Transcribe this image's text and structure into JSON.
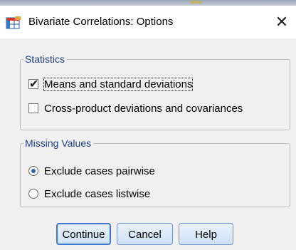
{
  "window": {
    "title": "Bivariate Correlations: Options",
    "close_glyph": "✕"
  },
  "statistics": {
    "legend": "Statistics",
    "means": {
      "label": "Means and standard deviations",
      "checked": true
    },
    "cross": {
      "label": "Cross-product deviations and covariances",
      "checked": false
    }
  },
  "missing_values": {
    "legend": "Missing Values",
    "pairwise": {
      "label": "Exclude cases pairwise",
      "selected": true
    },
    "listwise": {
      "label": "Exclude cases listwise",
      "selected": false
    }
  },
  "buttons": {
    "continue": "Continue",
    "cancel": "Cancel",
    "help": "Help"
  },
  "icons": {
    "app": "spss-table-icon",
    "close": "close-icon"
  },
  "colors": {
    "legend_text": "#1f3f86",
    "button_border": "#6e92c9",
    "radio_dot": "#2d64b8"
  }
}
